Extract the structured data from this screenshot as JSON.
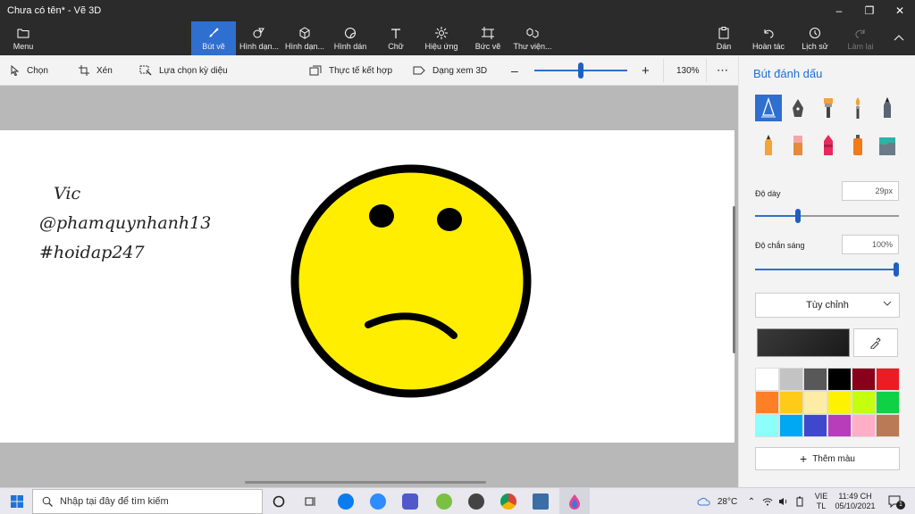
{
  "window": {
    "title": "Chưa có tên* - Vẽ 3D"
  },
  "ribbon": {
    "menu_label": "Menu",
    "tools": [
      {
        "label": "Bút vẽ",
        "icon": "brush-icon",
        "active": true
      },
      {
        "label": "Hình dạn...",
        "icon": "shapes-2d-icon"
      },
      {
        "label": "Hình dạn...",
        "icon": "shapes-3d-icon"
      },
      {
        "label": "Hình dán",
        "icon": "sticker-icon"
      },
      {
        "label": "Chữ",
        "icon": "text-icon"
      },
      {
        "label": "Hiệu ứng",
        "icon": "effects-icon"
      },
      {
        "label": "Bức vẽ",
        "icon": "canvas-icon"
      },
      {
        "label": "Thư viện...",
        "icon": "library-icon"
      }
    ],
    "right": [
      {
        "label": "Dán",
        "icon": "paste-icon"
      },
      {
        "label": "Hoàn tác",
        "icon": "undo-icon"
      },
      {
        "label": "Lịch sử",
        "icon": "history-icon"
      },
      {
        "label": "Làm lại",
        "icon": "redo-icon",
        "disabled": true
      }
    ]
  },
  "toolbar": {
    "select_label": "Chọn",
    "crop_label": "Xén",
    "magic_select_label": "Lựa chọn kỳ diệu",
    "mixed_reality_label": "Thực tế kết hợp",
    "view3d_label": "Dạng xem 3D",
    "zoom_label": "130%",
    "zoom_level": 0.5
  },
  "canvas": {
    "text_lines": [
      "Vic",
      "@phamquynhanh13",
      "#hoidap247"
    ]
  },
  "panel": {
    "title": "Bút đánh dấu",
    "thickness_label": "Độ dày",
    "thickness_value": "29px",
    "thickness_fraction": 0.29,
    "opacity_label": "Độ chắn sáng",
    "opacity_value": "100%",
    "opacity_fraction": 1.0,
    "texture_value": "Tùy chỉnh",
    "current_color": "#1a1a1a",
    "add_color_label": "Thêm màu",
    "palette": [
      "#ffffff",
      "#c3c3c3",
      "#585858",
      "#000000",
      "#88001b",
      "#ec1c24",
      "#ff7f27",
      "#ffca18",
      "#fdeca6",
      "#fff200",
      "#c4ff0e",
      "#0ed145",
      "#8cfffb",
      "#00a8f3",
      "#3f48cc",
      "#b83dba",
      "#ffaec8",
      "#b97a56"
    ]
  },
  "taskbar": {
    "search_placeholder": "Nhập tại đây để tìm kiếm",
    "temperature": "28°C",
    "lang_top": "VIE",
    "lang_bottom": "TL",
    "time": "11:49 CH",
    "date": "05/10/2021",
    "notification_count": "1"
  },
  "colors": {
    "accent": "#2f6fcf",
    "face": "#ffee00"
  }
}
